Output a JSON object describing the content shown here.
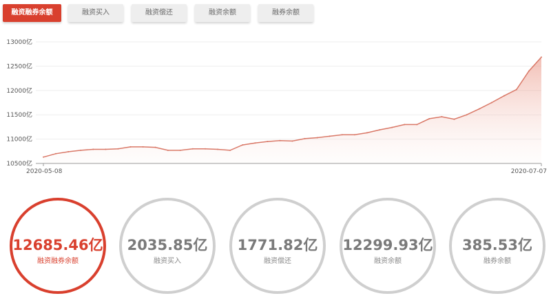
{
  "tabs": [
    {
      "label": "融资融券余额",
      "active": true
    },
    {
      "label": "融资买入",
      "active": false
    },
    {
      "label": "融资偿还",
      "active": false
    },
    {
      "label": "融资余额",
      "active": false
    },
    {
      "label": "融券余额",
      "active": false
    }
  ],
  "colors": {
    "accent": "#d9402e",
    "line": "#d97766",
    "inactive": "#cfcfcf"
  },
  "chart_data": {
    "type": "area",
    "xlabel": "",
    "ylabel": "",
    "ylim": [
      10500,
      13000
    ],
    "yticks": [
      "10500亿",
      "11000亿",
      "11500亿",
      "12000亿",
      "12500亿",
      "13000亿"
    ],
    "xtick_labels": [
      "2020-05-08",
      "2020-07-07"
    ],
    "grid": true,
    "series": [
      {
        "values": [
          10630,
          10700,
          10740,
          10770,
          10790,
          10790,
          10800,
          10840,
          10840,
          10830,
          10770,
          10770,
          10800,
          10800,
          10790,
          10770,
          10880,
          10920,
          10950,
          10970,
          10960,
          11010,
          11030,
          11060,
          11090,
          11090,
          11130,
          11190,
          11240,
          11300,
          11300,
          11420,
          11460,
          11410,
          11500,
          11620,
          11750,
          11890,
          12020,
          12400,
          12685
        ]
      }
    ]
  },
  "stats": [
    {
      "value": "12685.46亿",
      "label": "融资融券余额",
      "active": true
    },
    {
      "value": "2035.85亿",
      "label": "融资买入",
      "active": false
    },
    {
      "value": "1771.82亿",
      "label": "融资偿还",
      "active": false
    },
    {
      "value": "12299.93亿",
      "label": "融资余额",
      "active": false
    },
    {
      "value": "385.53亿",
      "label": "融券余额",
      "active": false
    }
  ]
}
